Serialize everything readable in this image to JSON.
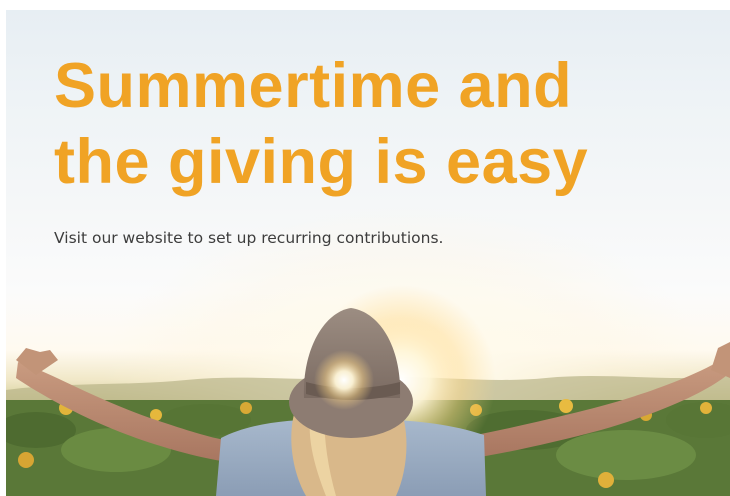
{
  "banner": {
    "headline_line1": "Summertime and",
    "headline_line2": "the giving is easy",
    "subtext": "Visit our website to set up recurring contributions."
  },
  "colors": {
    "headline": "#f0a325",
    "subtext": "#3d3d3d",
    "sky": "#eef3f6",
    "field": "#5b7a39"
  }
}
